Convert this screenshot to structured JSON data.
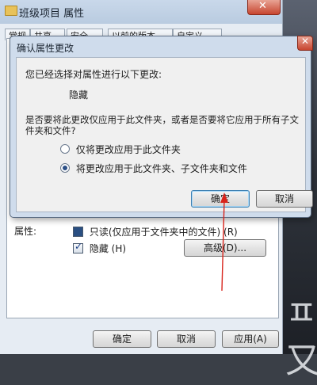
{
  "window": {
    "title": "班级项目 属性",
    "close_glyph": "✕",
    "tabs": [
      "常规",
      "共享",
      "安全",
      "以前的版本",
      "自定义"
    ]
  },
  "attributes": {
    "label": "属性:",
    "readonly": "只读(仅应用于文件夹中的文件)",
    "readonly_key": "(R)",
    "hidden": "隐藏",
    "hidden_key": "(H)",
    "advanced_button": "高级(D)..."
  },
  "bottom_buttons": {
    "ok": "确定",
    "cancel": "取消",
    "apply": "应用(A)"
  },
  "dialog": {
    "title": "确认属性更改",
    "close_glyph": "✕",
    "intro": "您已经选择对属性进行以下更改:",
    "change": "隐藏",
    "question_line1": "是否要将此更改仅应用于此文件夹，或者是否要将它应用于所有子文",
    "question_line2": "件夹和文件?",
    "option1": "仅将更改应用于此文件夹",
    "option2": "将更改应用于此文件夹、子文件夹和文件",
    "selected_option": 2,
    "ok": "确定",
    "cancel": "取消"
  },
  "background_glyph": "ㅍ又",
  "colors": {
    "annotation": "#d8241c",
    "title_bar": "#c9d8ea"
  }
}
